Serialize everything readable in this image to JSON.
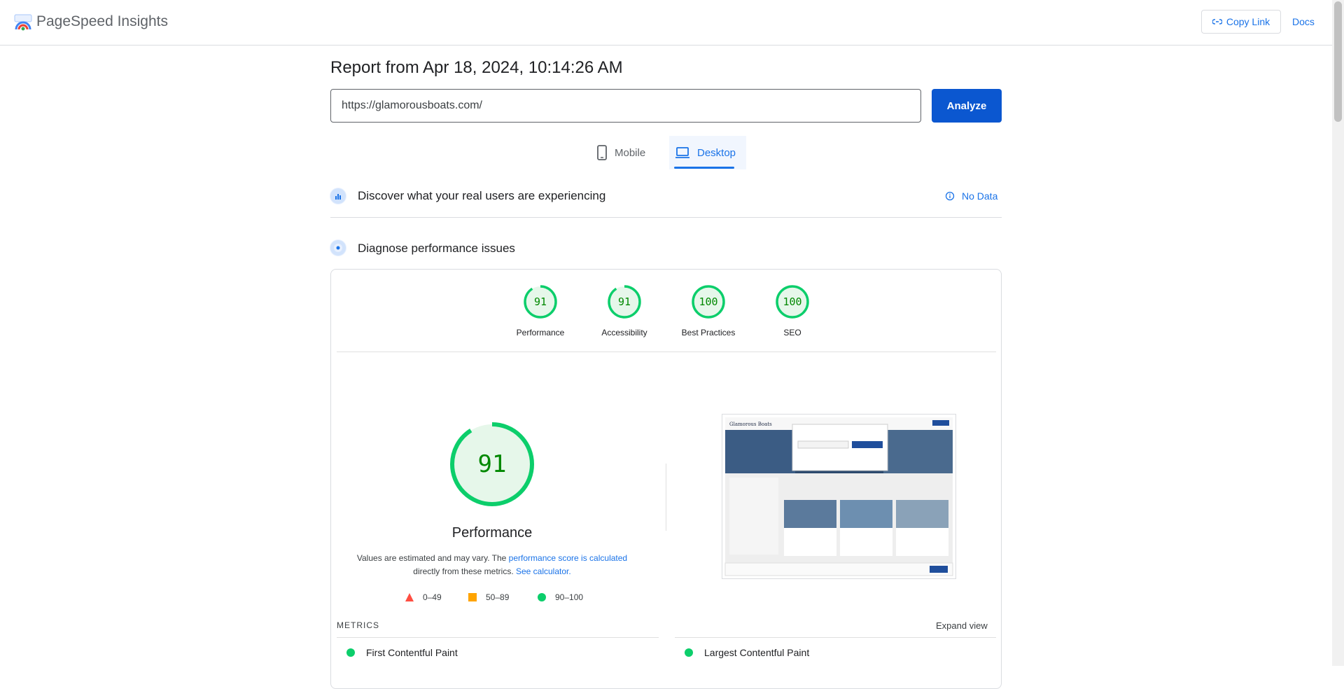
{
  "header": {
    "brand": "PageSpeed Insights",
    "copy_link": "Copy Link",
    "docs": "Docs"
  },
  "report": {
    "title": "Report from Apr 18, 2024, 10:14:26 AM",
    "url_value": "https://glamorousboats.com/",
    "analyze_label": "Analyze"
  },
  "tabs": [
    {
      "label": "Mobile",
      "active": false
    },
    {
      "label": "Desktop",
      "active": true
    }
  ],
  "real_users": {
    "title": "Discover what your real users are experiencing",
    "status": "No Data"
  },
  "diagnose": {
    "title": "Diagnose performance issues"
  },
  "scores": [
    {
      "label": "Performance",
      "score": "91"
    },
    {
      "label": "Accessibility",
      "score": "91"
    },
    {
      "label": "Best Practices",
      "score": "100"
    },
    {
      "label": "SEO",
      "score": "100"
    }
  ],
  "performance": {
    "score": "91",
    "title": "Performance",
    "note_1": "Values are estimated and may vary. The ",
    "note_link_1": "performance score is calculated",
    "note_2": " directly from these metrics. ",
    "note_link_2": "See calculator."
  },
  "legend": [
    {
      "range": "0–49",
      "shape": "triangle",
      "color": "#ff4e42"
    },
    {
      "range": "50–89",
      "shape": "square",
      "color": "#ffa400"
    },
    {
      "range": "90–100",
      "shape": "circle",
      "color": "#0cce6b"
    }
  ],
  "metrics": {
    "label": "METRICS",
    "expand": "Expand view",
    "items": [
      {
        "name": "First Contentful Paint"
      },
      {
        "name": "Largest Contentful Paint"
      }
    ]
  },
  "colors": {
    "pass_green": "#0cce6b",
    "score_text": "#008800",
    "gauge_bg": "#e6f7ea",
    "accent": "#1a73e8"
  }
}
